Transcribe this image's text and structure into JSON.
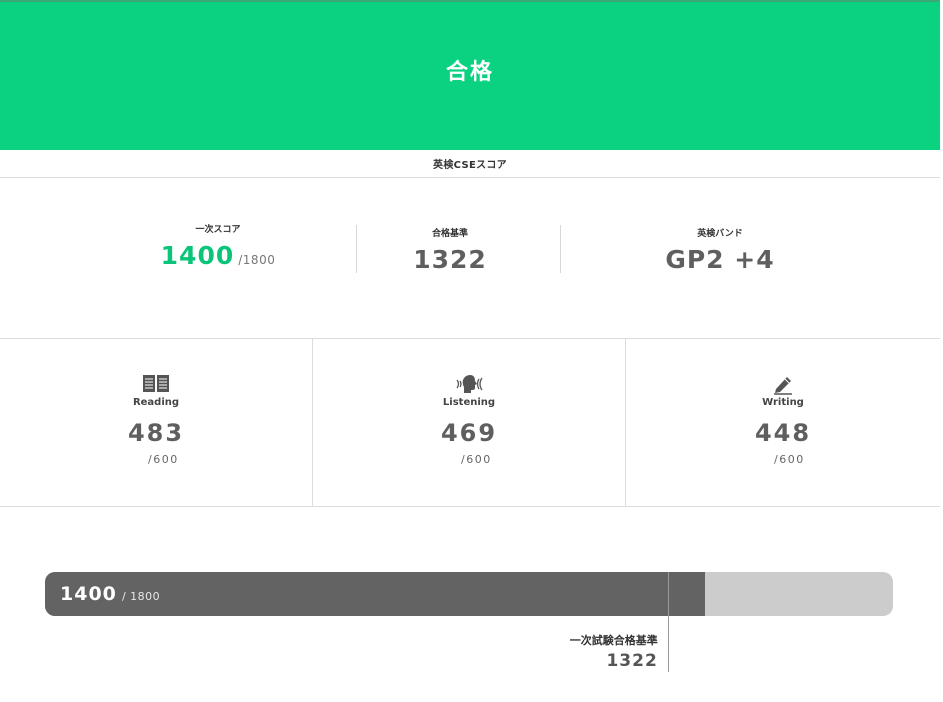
{
  "result": {
    "title": "合格"
  },
  "section_label": "英検CSEスコア",
  "summary": {
    "first_score": {
      "label": "一次スコア",
      "value": "1400",
      "max": "/1800"
    },
    "pass_standard": {
      "label": "合格基準",
      "value": "1322"
    },
    "band": {
      "label": "英検バンド",
      "value": "GP2 +4"
    }
  },
  "skills": [
    {
      "name": "Reading",
      "score": "483",
      "max": "/600",
      "icon": "book-icon"
    },
    {
      "name": "Listening",
      "score": "469",
      "max": "/600",
      "icon": "listening-head-icon"
    },
    {
      "name": "Writing",
      "score": "448",
      "max": "/600",
      "icon": "pencil-icon"
    }
  ],
  "progress": {
    "value_label": "1400",
    "max_label": "/ 1800",
    "fraction": 0.7778,
    "threshold_fraction": 0.7344,
    "threshold_label": "一次試験合格基準",
    "threshold_value": "1322"
  },
  "colors": {
    "accent": "#0ad280",
    "score_green": "#0ac47a",
    "bar_fill": "#636363",
    "bar_track": "#cccccc"
  }
}
